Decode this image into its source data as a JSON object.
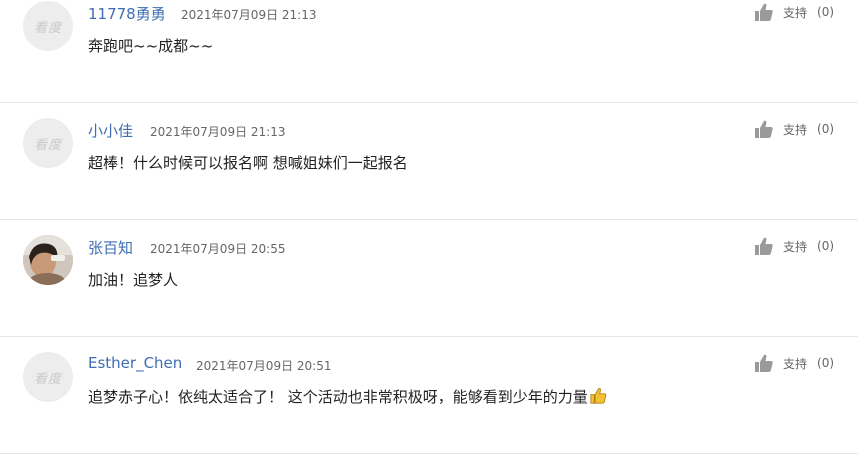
{
  "comments": [
    {
      "username": "11778勇勇",
      "time": "2021年07月09日 21:13",
      "content": "奔跑吧~~成都~~",
      "support_label": "支持",
      "support_count": "(0)",
      "avatar": "看度",
      "avatar_type": "placeholder"
    },
    {
      "username": "小小佳",
      "time": "2021年07月09日 21:13",
      "content": "超棒！什么时候可以报名啊 想喊姐妹们一起报名",
      "support_label": "支持",
      "support_count": "(0)",
      "avatar": "看度",
      "avatar_type": "placeholder"
    },
    {
      "username": "张百知",
      "time": "2021年07月09日 20:55",
      "content": "加油！追梦人",
      "support_label": "支持",
      "support_count": "(0)",
      "avatar_type": "photo"
    },
    {
      "username": "Esther_Chen",
      "time": "2021年07月09日 20:51",
      "content": "追梦赤子心！依纯太适合了！ 这个活动也非常积极呀，能够看到少年的力量",
      "support_label": "支持",
      "support_count": "(0)",
      "avatar": "看度",
      "avatar_type": "placeholder",
      "trailing_icon": "thumbs-up-emoji"
    }
  ],
  "colors": {
    "username": "#3d6db5",
    "divider": "#e6e6e6",
    "text": "#222222",
    "meta": "#666666",
    "icon": "#999999"
  }
}
